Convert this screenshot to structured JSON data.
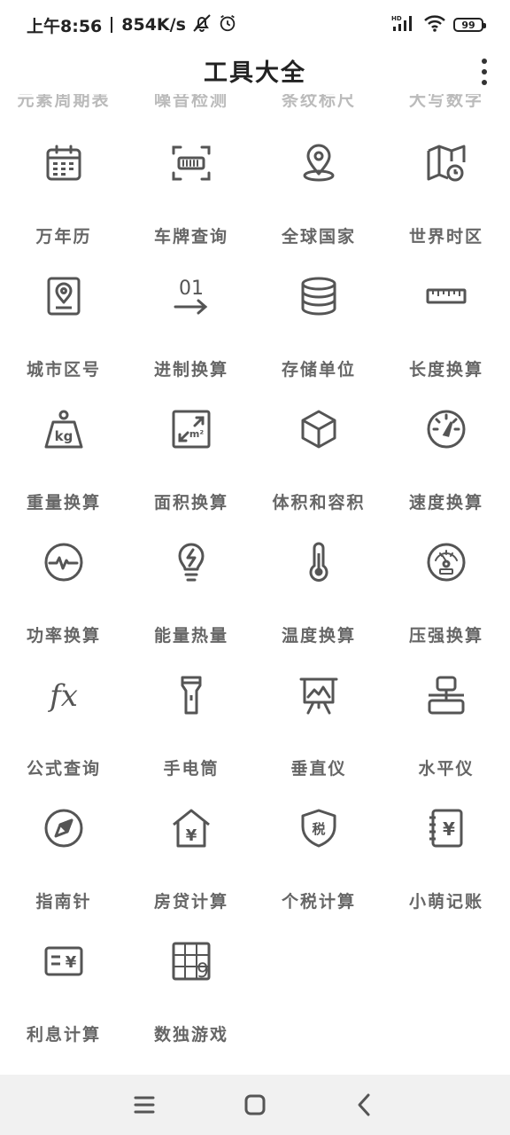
{
  "status_bar": {
    "time": "上午8:56",
    "net_speed": "854K/s",
    "hd_label": "HD",
    "battery": "99"
  },
  "header": {
    "title": "工具大全"
  },
  "partial_row": [
    "元素周期表",
    "噪音检测",
    "条纹标尺",
    "大写数字"
  ],
  "tools": [
    {
      "label": "万年历",
      "icon": "calendar-icon"
    },
    {
      "label": "车牌查询",
      "icon": "license-plate-icon"
    },
    {
      "label": "全球国家",
      "icon": "location-pin-icon"
    },
    {
      "label": "世界时区",
      "icon": "map-clock-icon"
    },
    {
      "label": "城市区号",
      "icon": "city-code-icon"
    },
    {
      "label": "进制换算",
      "icon": "binary-convert-icon"
    },
    {
      "label": "存储单位",
      "icon": "database-icon"
    },
    {
      "label": "长度换算",
      "icon": "ruler-icon"
    },
    {
      "label": "重量换算",
      "icon": "kg-weight-icon"
    },
    {
      "label": "面积换算",
      "icon": "area-icon"
    },
    {
      "label": "体积和容积",
      "icon": "cube-icon"
    },
    {
      "label": "速度换算",
      "icon": "speedometer-icon"
    },
    {
      "label": "功率换算",
      "icon": "power-pulse-icon"
    },
    {
      "label": "能量热量",
      "icon": "energy-bulb-icon"
    },
    {
      "label": "温度换算",
      "icon": "thermometer-icon"
    },
    {
      "label": "压强换算",
      "icon": "pressure-gauge-icon"
    },
    {
      "label": "公式查询",
      "icon": "formula-icon"
    },
    {
      "label": "手电筒",
      "icon": "flashlight-icon"
    },
    {
      "label": "垂直仪",
      "icon": "vertical-level-icon"
    },
    {
      "label": "水平仪",
      "icon": "horizontal-level-icon"
    },
    {
      "label": "指南针",
      "icon": "compass-icon"
    },
    {
      "label": "房贷计算",
      "icon": "mortgage-house-icon"
    },
    {
      "label": "个税计算",
      "icon": "tax-shield-icon"
    },
    {
      "label": "小萌记账",
      "icon": "ledger-icon"
    },
    {
      "label": "利息计算",
      "icon": "interest-card-icon"
    },
    {
      "label": "数独游戏",
      "icon": "sudoku-icon"
    }
  ],
  "icon_glyphs": {
    "binary": "01",
    "kg": "kg",
    "area_unit": "m²",
    "formula": "fx",
    "yuan": "¥",
    "tax": "税",
    "sudoku_digit": "9"
  },
  "colors": {
    "icon": "#555555",
    "label": "#666666",
    "faded_label": "#bbbbbb",
    "nav_bg": "#f1f1f1"
  }
}
